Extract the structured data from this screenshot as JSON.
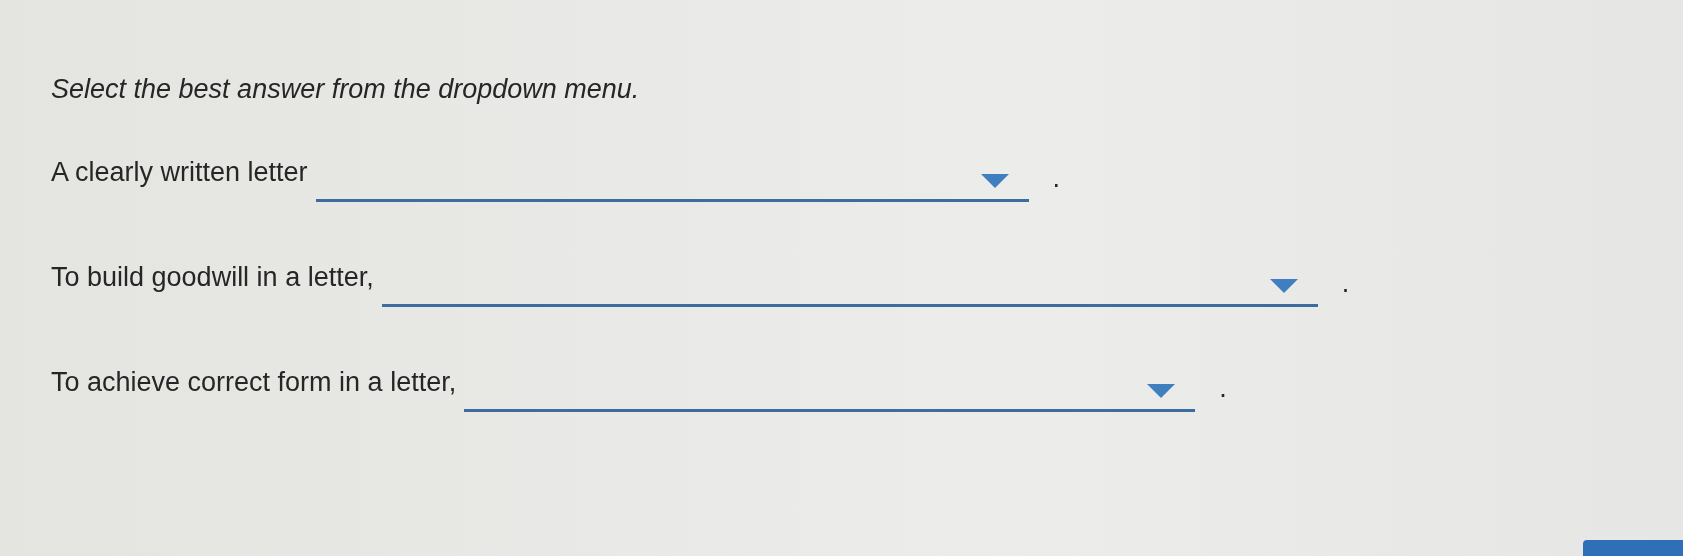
{
  "instruction": "Select the best answer from the dropdown menu.",
  "questions": [
    {
      "prompt": "A clearly written letter",
      "end": "."
    },
    {
      "prompt": "To build goodwill in a letter,",
      "end": "."
    },
    {
      "prompt": "To achieve correct form in a letter,",
      "end": "."
    }
  ]
}
